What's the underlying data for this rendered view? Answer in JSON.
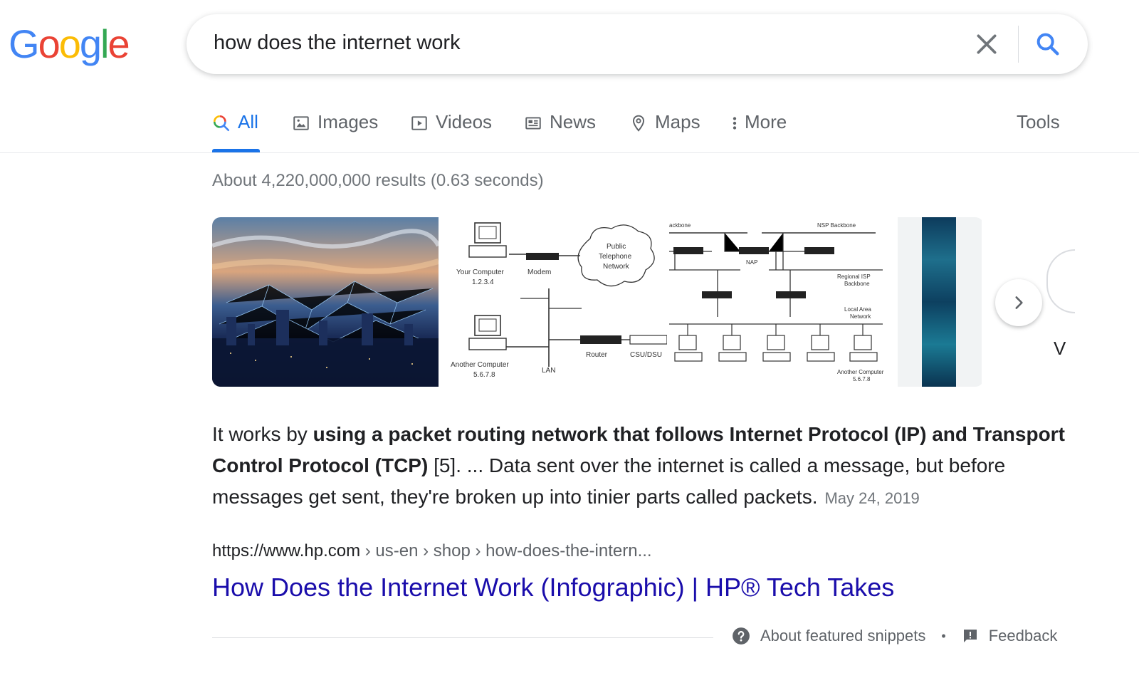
{
  "logo": {
    "letters": [
      "G",
      "o",
      "o",
      "g",
      "l",
      "e"
    ],
    "colors": [
      "#4285F4",
      "#EA4335",
      "#FBBC05",
      "#4285F4",
      "#34A853",
      "#EA4335"
    ]
  },
  "search": {
    "query": "how does the internet work"
  },
  "tabs": [
    {
      "label": "All",
      "icon": "search-icon",
      "active": true
    },
    {
      "label": "Images",
      "icon": "image-icon"
    },
    {
      "label": "Videos",
      "icon": "play-icon"
    },
    {
      "label": "News",
      "icon": "news-icon"
    },
    {
      "label": "Maps",
      "icon": "map-pin-icon"
    },
    {
      "label": "More",
      "icon": "more-vertical-icon"
    }
  ],
  "tools_label": "Tools",
  "result_stats": "About 4,220,000,000 results (0.63 seconds)",
  "images": {
    "diagram1": {
      "your_computer": "Your Computer",
      "your_ip": "1.2.3.4",
      "modem": "Modem",
      "pstn_1": "Public",
      "pstn_2": "Telephone",
      "pstn_3": "Network",
      "another_computer": "Another Computer",
      "another_ip": "5.6.7.8",
      "lan": "LAN",
      "router": "Router",
      "csu": "CSU/DSU"
    },
    "diagram2": {
      "backbone": "ackbone",
      "nsp": "NSP Backbone",
      "nap": "NAP",
      "regional_1": "Regional ISP",
      "regional_2": "Backbone",
      "lan_1": "Local Area",
      "lan_2": "Network",
      "another_1": "Another Computer",
      "another_2": "5.6.7.8"
    },
    "partial_letter": "V"
  },
  "snippet": {
    "lead": "It works by ",
    "bold": "using a packet routing network that follows Internet Protocol (IP) and Transport Control Protocol (TCP)",
    "rest": " [5]. ... Data sent over the internet is called a message, but before messages get sent, they're broken up into tinier parts called packets.",
    "date": "May 24, 2019"
  },
  "result": {
    "domain": "https://www.hp.com",
    "path": " › us-en › shop › how-does-the-intern...",
    "title": "How Does the Internet Work (Infographic) | HP® Tech Takes"
  },
  "footer": {
    "about": "About featured snippets",
    "separator": "•",
    "feedback": "Feedback"
  }
}
